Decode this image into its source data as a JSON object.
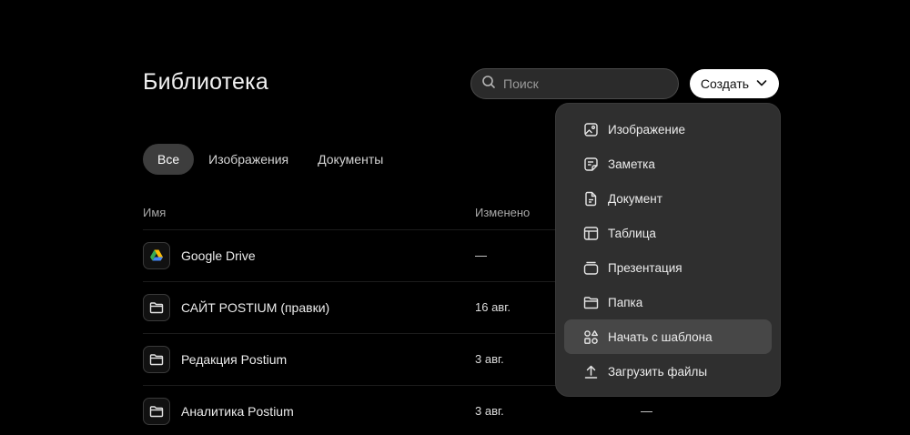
{
  "header": {
    "title": "Библиотека"
  },
  "search": {
    "placeholder": "Поиск",
    "value": ""
  },
  "create_button": {
    "label": "Создать"
  },
  "tabs": [
    {
      "label": "Все",
      "active": true
    },
    {
      "label": "Изображения",
      "active": false
    },
    {
      "label": "Документы",
      "active": false
    }
  ],
  "columns": {
    "name": "Имя",
    "modified": "Изменено"
  },
  "rows": [
    {
      "icon": "google-drive-icon",
      "name": "Google Drive",
      "modified": "—",
      "extra": ""
    },
    {
      "icon": "folder-icon",
      "name": "САЙТ POSTIUM (правки)",
      "modified": "16 авг.",
      "extra": ""
    },
    {
      "icon": "folder-icon",
      "name": "Редакция Postium",
      "modified": "3 авг.",
      "extra": ""
    },
    {
      "icon": "folder-icon",
      "name": "Аналитика Postium",
      "modified": "3 авг.",
      "extra": "—"
    }
  ],
  "create_menu": {
    "items": [
      {
        "icon": "image-icon",
        "label": "Изображение"
      },
      {
        "icon": "note-icon",
        "label": "Заметка"
      },
      {
        "icon": "document-icon",
        "label": "Документ"
      },
      {
        "icon": "table-icon",
        "label": "Таблица"
      },
      {
        "icon": "presentation-icon",
        "label": "Презентация"
      },
      {
        "icon": "folder-icon",
        "label": "Папка"
      },
      {
        "icon": "template-icon",
        "label": "Начать с шаблона",
        "highlighted": true
      },
      {
        "icon": "upload-icon",
        "label": "Загрузить файлы"
      }
    ]
  },
  "colors": {
    "background": "#000000",
    "menu_background": "#2f2f2f",
    "active_tab": "#3d3d3d",
    "create_button": "#ffffff"
  }
}
